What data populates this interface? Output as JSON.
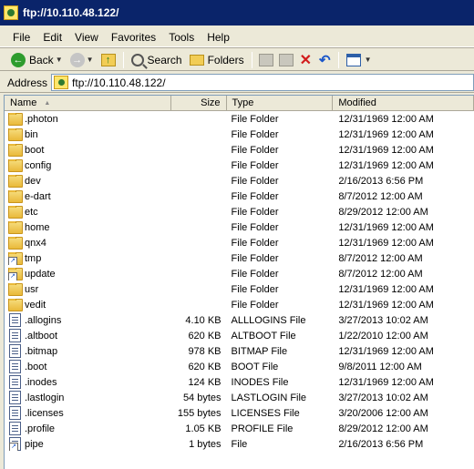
{
  "window": {
    "title": "ftp://10.110.48.122/"
  },
  "menu": [
    "File",
    "Edit",
    "View",
    "Favorites",
    "Tools",
    "Help"
  ],
  "toolbar": {
    "back_label": "Back",
    "search_label": "Search",
    "folders_label": "Folders"
  },
  "address": {
    "label": "Address",
    "value": "ftp://10.110.48.122/"
  },
  "columns": {
    "name": "Name",
    "size": "Size",
    "type": "Type",
    "modified": "Modified"
  },
  "files": [
    {
      "name": ".photon",
      "size": "",
      "type": "File Folder",
      "modified": "12/31/1969 12:00 AM",
      "icon": "folder"
    },
    {
      "name": "bin",
      "size": "",
      "type": "File Folder",
      "modified": "12/31/1969 12:00 AM",
      "icon": "folder"
    },
    {
      "name": "boot",
      "size": "",
      "type": "File Folder",
      "modified": "12/31/1969 12:00 AM",
      "icon": "folder"
    },
    {
      "name": "config",
      "size": "",
      "type": "File Folder",
      "modified": "12/31/1969 12:00 AM",
      "icon": "folder"
    },
    {
      "name": "dev",
      "size": "",
      "type": "File Folder",
      "modified": "2/16/2013 6:56 PM",
      "icon": "folder"
    },
    {
      "name": "e-dart",
      "size": "",
      "type": "File Folder",
      "modified": "8/7/2012 12:00 AM",
      "icon": "folder"
    },
    {
      "name": "etc",
      "size": "",
      "type": "File Folder",
      "modified": "8/29/2012 12:00 AM",
      "icon": "folder"
    },
    {
      "name": "home",
      "size": "",
      "type": "File Folder",
      "modified": "12/31/1969 12:00 AM",
      "icon": "folder"
    },
    {
      "name": "qnx4",
      "size": "",
      "type": "File Folder",
      "modified": "12/31/1969 12:00 AM",
      "icon": "folder"
    },
    {
      "name": "tmp",
      "size": "",
      "type": "File Folder",
      "modified": "8/7/2012 12:00 AM",
      "icon": "folder-link"
    },
    {
      "name": "update",
      "size": "",
      "type": "File Folder",
      "modified": "8/7/2012 12:00 AM",
      "icon": "folder-link"
    },
    {
      "name": "usr",
      "size": "",
      "type": "File Folder",
      "modified": "12/31/1969 12:00 AM",
      "icon": "folder"
    },
    {
      "name": "vedit",
      "size": "",
      "type": "File Folder",
      "modified": "12/31/1969 12:00 AM",
      "icon": "folder"
    },
    {
      "name": ".allogins",
      "size": "4.10 KB",
      "type": "ALLLOGINS File",
      "modified": "3/27/2013 10:02 AM",
      "icon": "file"
    },
    {
      "name": ".altboot",
      "size": "620 KB",
      "type": "ALTBOOT File",
      "modified": "1/22/2010 12:00 AM",
      "icon": "file"
    },
    {
      "name": ".bitmap",
      "size": "978 KB",
      "type": "BITMAP File",
      "modified": "12/31/1969 12:00 AM",
      "icon": "file"
    },
    {
      "name": ".boot",
      "size": "620 KB",
      "type": "BOOT File",
      "modified": "9/8/2011 12:00 AM",
      "icon": "file"
    },
    {
      "name": ".inodes",
      "size": "124 KB",
      "type": "INODES File",
      "modified": "12/31/1969 12:00 AM",
      "icon": "file"
    },
    {
      "name": ".lastlogin",
      "size": "54 bytes",
      "type": "LASTLOGIN File",
      "modified": "3/27/2013 10:02 AM",
      "icon": "file"
    },
    {
      "name": ".licenses",
      "size": "155 bytes",
      "type": "LICENSES File",
      "modified": "3/20/2006 12:00 AM",
      "icon": "file"
    },
    {
      "name": ".profile",
      "size": "1.05 KB",
      "type": "PROFILE File",
      "modified": "8/29/2012 12:00 AM",
      "icon": "file"
    },
    {
      "name": "pipe",
      "size": "1 bytes",
      "type": "File",
      "modified": "2/16/2013 6:56 PM",
      "icon": "file-link"
    }
  ]
}
